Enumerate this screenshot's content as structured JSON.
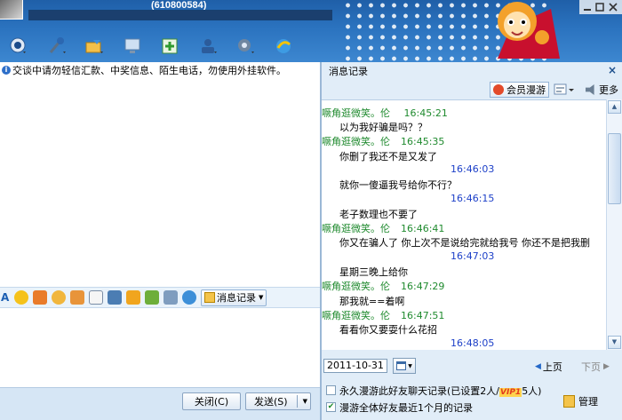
{
  "window": {
    "qq_number": "(610800584)"
  },
  "notice": {
    "text": "交谈中请勿轻信汇款、中奖信息、陌生电话，勿使用外挂软件。"
  },
  "midbar": {
    "history_label": "消息记录"
  },
  "buttons": {
    "close_label": "关闭(C)",
    "send_label": "发送(S)"
  },
  "history_panel": {
    "title": "消息记录",
    "close_glyph": "×",
    "vip_roam_label": "会员漫游",
    "more_label": "更多",
    "messages": [
      {
        "kind": "body",
        "text": "以为我好骗是吗？？"
      },
      {
        "kind": "header",
        "sender": "噘角逛微笑。伦",
        "time": "16:45:35"
      },
      {
        "kind": "body",
        "text": "你删了我还不是又发了"
      },
      {
        "kind": "self",
        "time": "16:46:03"
      },
      {
        "kind": "body",
        "text": "就你一傻逼我号给你不行？"
      },
      {
        "kind": "self",
        "time": "16:46:15"
      },
      {
        "kind": "body",
        "text": "老子数理也不要了"
      },
      {
        "kind": "header",
        "sender": "噘角逛微笑。伦",
        "time": "16:46:41"
      },
      {
        "kind": "body",
        "text": "你又在骗人了 你上次不是说给完就给我号 你还不是把我删"
      },
      {
        "kind": "self",
        "time": "16:47:03"
      },
      {
        "kind": "body",
        "text": "星期三晚上给你"
      },
      {
        "kind": "header",
        "sender": "噘角逛微笑。伦",
        "time": "16:47:29"
      },
      {
        "kind": "body",
        "text": "那我就==着啊"
      },
      {
        "kind": "header",
        "sender": "噘角逛微笑。伦",
        "time": "16:47:51"
      },
      {
        "kind": "body",
        "text": "看看你又要耍什么花招"
      },
      {
        "kind": "self",
        "time": "16:48:05"
      }
    ],
    "first_header": {
      "sender": "噘角逛微笑。伦",
      "time": "16:45:21"
    },
    "date_value": "2011-10-31",
    "prev_page": "上页",
    "next_page": "下页",
    "option_permanent_roam": {
      "text_a": "永久漫游此好友聊天记录(已设置2人/",
      "vip": "VIP1",
      "text_b": "5人)",
      "checked": false
    },
    "option_roam_all": {
      "text": "漫游全体好友最近1个月的记录",
      "checked": true
    },
    "manage_label": "管理"
  },
  "colors": {
    "sender_green": "#1f8a2e",
    "self_time_blue": "#1c3fc8",
    "banner_blue": "#2b73bf"
  },
  "icons": [
    "camera-icon",
    "microphone-icon",
    "folder-share-icon",
    "screen-icon",
    "add-app-icon",
    "profile-icon",
    "settings-icon",
    "browser-icon"
  ]
}
